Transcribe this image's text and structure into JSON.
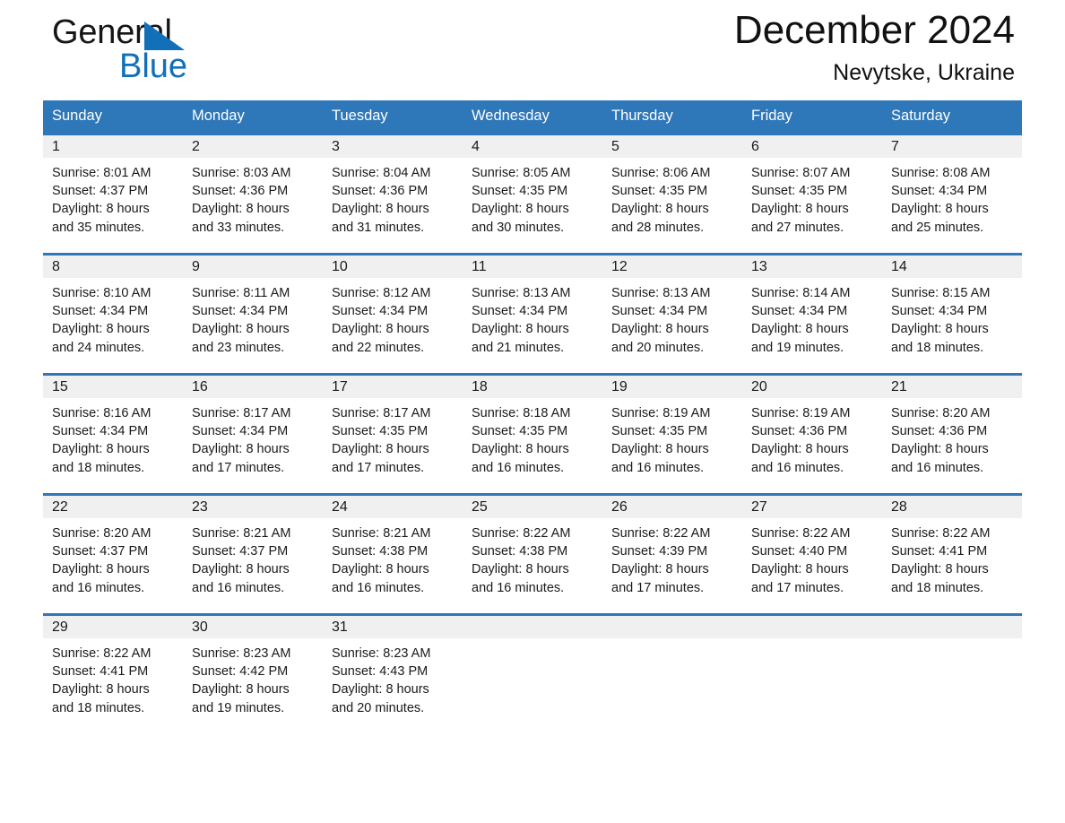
{
  "brand": {
    "name_part1": "General",
    "name_part2": "Blue",
    "logo_icon": "triangle-logo-icon",
    "accent_color": "#1270b8"
  },
  "header": {
    "month_title": "December 2024",
    "location": "Nevytske, Ukraine"
  },
  "colors": {
    "header_blue": "#2e77b8",
    "row_divider_blue": "#2e77b8",
    "daynum_band": "#f0f0f0",
    "text": "#1a1a1a"
  },
  "calendar": {
    "weekdays": [
      "Sunday",
      "Monday",
      "Tuesday",
      "Wednesday",
      "Thursday",
      "Friday",
      "Saturday"
    ],
    "weeks": [
      [
        {
          "day": "1",
          "sunrise": "Sunrise: 8:01 AM",
          "sunset": "Sunset: 4:37 PM",
          "daylight_line1": "Daylight: 8 hours",
          "daylight_line2": "and 35 minutes."
        },
        {
          "day": "2",
          "sunrise": "Sunrise: 8:03 AM",
          "sunset": "Sunset: 4:36 PM",
          "daylight_line1": "Daylight: 8 hours",
          "daylight_line2": "and 33 minutes."
        },
        {
          "day": "3",
          "sunrise": "Sunrise: 8:04 AM",
          "sunset": "Sunset: 4:36 PM",
          "daylight_line1": "Daylight: 8 hours",
          "daylight_line2": "and 31 minutes."
        },
        {
          "day": "4",
          "sunrise": "Sunrise: 8:05 AM",
          "sunset": "Sunset: 4:35 PM",
          "daylight_line1": "Daylight: 8 hours",
          "daylight_line2": "and 30 minutes."
        },
        {
          "day": "5",
          "sunrise": "Sunrise: 8:06 AM",
          "sunset": "Sunset: 4:35 PM",
          "daylight_line1": "Daylight: 8 hours",
          "daylight_line2": "and 28 minutes."
        },
        {
          "day": "6",
          "sunrise": "Sunrise: 8:07 AM",
          "sunset": "Sunset: 4:35 PM",
          "daylight_line1": "Daylight: 8 hours",
          "daylight_line2": "and 27 minutes."
        },
        {
          "day": "7",
          "sunrise": "Sunrise: 8:08 AM",
          "sunset": "Sunset: 4:34 PM",
          "daylight_line1": "Daylight: 8 hours",
          "daylight_line2": "and 25 minutes."
        }
      ],
      [
        {
          "day": "8",
          "sunrise": "Sunrise: 8:10 AM",
          "sunset": "Sunset: 4:34 PM",
          "daylight_line1": "Daylight: 8 hours",
          "daylight_line2": "and 24 minutes."
        },
        {
          "day": "9",
          "sunrise": "Sunrise: 8:11 AM",
          "sunset": "Sunset: 4:34 PM",
          "daylight_line1": "Daylight: 8 hours",
          "daylight_line2": "and 23 minutes."
        },
        {
          "day": "10",
          "sunrise": "Sunrise: 8:12 AM",
          "sunset": "Sunset: 4:34 PM",
          "daylight_line1": "Daylight: 8 hours",
          "daylight_line2": "and 22 minutes."
        },
        {
          "day": "11",
          "sunrise": "Sunrise: 8:13 AM",
          "sunset": "Sunset: 4:34 PM",
          "daylight_line1": "Daylight: 8 hours",
          "daylight_line2": "and 21 minutes."
        },
        {
          "day": "12",
          "sunrise": "Sunrise: 8:13 AM",
          "sunset": "Sunset: 4:34 PM",
          "daylight_line1": "Daylight: 8 hours",
          "daylight_line2": "and 20 minutes."
        },
        {
          "day": "13",
          "sunrise": "Sunrise: 8:14 AM",
          "sunset": "Sunset: 4:34 PM",
          "daylight_line1": "Daylight: 8 hours",
          "daylight_line2": "and 19 minutes."
        },
        {
          "day": "14",
          "sunrise": "Sunrise: 8:15 AM",
          "sunset": "Sunset: 4:34 PM",
          "daylight_line1": "Daylight: 8 hours",
          "daylight_line2": "and 18 minutes."
        }
      ],
      [
        {
          "day": "15",
          "sunrise": "Sunrise: 8:16 AM",
          "sunset": "Sunset: 4:34 PM",
          "daylight_line1": "Daylight: 8 hours",
          "daylight_line2": "and 18 minutes."
        },
        {
          "day": "16",
          "sunrise": "Sunrise: 8:17 AM",
          "sunset": "Sunset: 4:34 PM",
          "daylight_line1": "Daylight: 8 hours",
          "daylight_line2": "and 17 minutes."
        },
        {
          "day": "17",
          "sunrise": "Sunrise: 8:17 AM",
          "sunset": "Sunset: 4:35 PM",
          "daylight_line1": "Daylight: 8 hours",
          "daylight_line2": "and 17 minutes."
        },
        {
          "day": "18",
          "sunrise": "Sunrise: 8:18 AM",
          "sunset": "Sunset: 4:35 PM",
          "daylight_line1": "Daylight: 8 hours",
          "daylight_line2": "and 16 minutes."
        },
        {
          "day": "19",
          "sunrise": "Sunrise: 8:19 AM",
          "sunset": "Sunset: 4:35 PM",
          "daylight_line1": "Daylight: 8 hours",
          "daylight_line2": "and 16 minutes."
        },
        {
          "day": "20",
          "sunrise": "Sunrise: 8:19 AM",
          "sunset": "Sunset: 4:36 PM",
          "daylight_line1": "Daylight: 8 hours",
          "daylight_line2": "and 16 minutes."
        },
        {
          "day": "21",
          "sunrise": "Sunrise: 8:20 AM",
          "sunset": "Sunset: 4:36 PM",
          "daylight_line1": "Daylight: 8 hours",
          "daylight_line2": "and 16 minutes."
        }
      ],
      [
        {
          "day": "22",
          "sunrise": "Sunrise: 8:20 AM",
          "sunset": "Sunset: 4:37 PM",
          "daylight_line1": "Daylight: 8 hours",
          "daylight_line2": "and 16 minutes."
        },
        {
          "day": "23",
          "sunrise": "Sunrise: 8:21 AM",
          "sunset": "Sunset: 4:37 PM",
          "daylight_line1": "Daylight: 8 hours",
          "daylight_line2": "and 16 minutes."
        },
        {
          "day": "24",
          "sunrise": "Sunrise: 8:21 AM",
          "sunset": "Sunset: 4:38 PM",
          "daylight_line1": "Daylight: 8 hours",
          "daylight_line2": "and 16 minutes."
        },
        {
          "day": "25",
          "sunrise": "Sunrise: 8:22 AM",
          "sunset": "Sunset: 4:38 PM",
          "daylight_line1": "Daylight: 8 hours",
          "daylight_line2": "and 16 minutes."
        },
        {
          "day": "26",
          "sunrise": "Sunrise: 8:22 AM",
          "sunset": "Sunset: 4:39 PM",
          "daylight_line1": "Daylight: 8 hours",
          "daylight_line2": "and 17 minutes."
        },
        {
          "day": "27",
          "sunrise": "Sunrise: 8:22 AM",
          "sunset": "Sunset: 4:40 PM",
          "daylight_line1": "Daylight: 8 hours",
          "daylight_line2": "and 17 minutes."
        },
        {
          "day": "28",
          "sunrise": "Sunrise: 8:22 AM",
          "sunset": "Sunset: 4:41 PM",
          "daylight_line1": "Daylight: 8 hours",
          "daylight_line2": "and 18 minutes."
        }
      ],
      [
        {
          "day": "29",
          "sunrise": "Sunrise: 8:22 AM",
          "sunset": "Sunset: 4:41 PM",
          "daylight_line1": "Daylight: 8 hours",
          "daylight_line2": "and 18 minutes."
        },
        {
          "day": "30",
          "sunrise": "Sunrise: 8:23 AM",
          "sunset": "Sunset: 4:42 PM",
          "daylight_line1": "Daylight: 8 hours",
          "daylight_line2": "and 19 minutes."
        },
        {
          "day": "31",
          "sunrise": "Sunrise: 8:23 AM",
          "sunset": "Sunset: 4:43 PM",
          "daylight_line1": "Daylight: 8 hours",
          "daylight_line2": "and 20 minutes."
        },
        {
          "day": "",
          "sunrise": "",
          "sunset": "",
          "daylight_line1": "",
          "daylight_line2": ""
        },
        {
          "day": "",
          "sunrise": "",
          "sunset": "",
          "daylight_line1": "",
          "daylight_line2": ""
        },
        {
          "day": "",
          "sunrise": "",
          "sunset": "",
          "daylight_line1": "",
          "daylight_line2": ""
        },
        {
          "day": "",
          "sunrise": "",
          "sunset": "",
          "daylight_line1": "",
          "daylight_line2": ""
        }
      ]
    ]
  }
}
